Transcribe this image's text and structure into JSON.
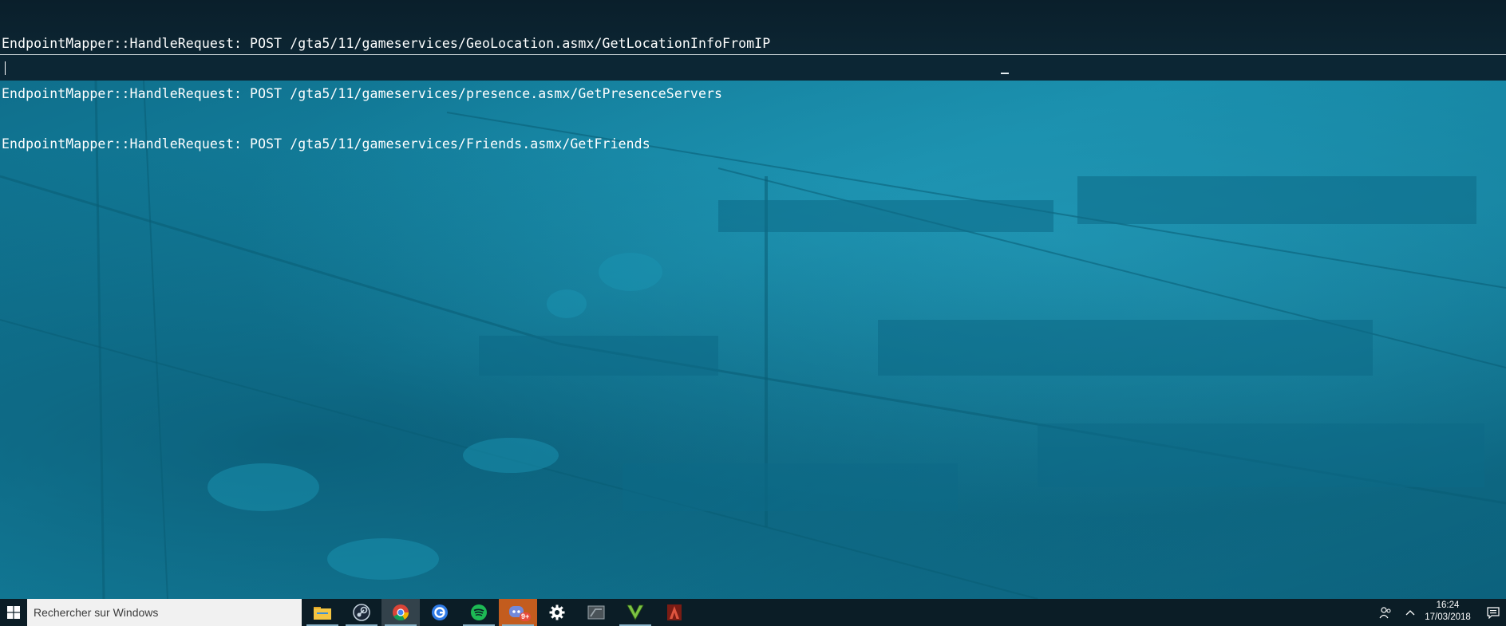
{
  "console": {
    "log_lines": [
      "EndpointMapper::HandleRequest: POST /gta5/11/gameservices/GeoLocation.asmx/GetLocationInfoFromIP",
      "EndpointMapper::HandleRequest: POST /gta5/11/gameservices/presence.asmx/GetPresenceServers",
      "EndpointMapper::HandleRequest: POST /gta5/11/gameservices/Friends.asmx/GetFriends"
    ],
    "input_value": ""
  },
  "taskbar": {
    "search_placeholder": "Rechercher sur Windows",
    "start_icon": "windows-logo-icon",
    "apps": [
      {
        "name": "file-explorer-icon",
        "color": "#f4c542"
      },
      {
        "name": "steam-icon",
        "color": "#c7d5e0"
      },
      {
        "name": "chrome-icon",
        "color": "#db4437"
      },
      {
        "name": "app-g-icon",
        "color": "#2f7be6"
      },
      {
        "name": "spotify-icon",
        "color": "#1db954"
      },
      {
        "name": "discord-icon",
        "color": "#7289da",
        "badge": "9+"
      },
      {
        "name": "settings-gear-icon",
        "color": "#ffffff"
      },
      {
        "name": "gta-launcher-icon",
        "color": "#9aa5ab"
      },
      {
        "name": "gta-v-icon",
        "color": "#7cc243"
      },
      {
        "name": "game-red-icon",
        "color": "#c0392b"
      }
    ],
    "tray": {
      "people_icon": "people-icon",
      "chevron_icon": "chevron-up-icon",
      "notification_icon": "notification-center-icon"
    },
    "clock": {
      "time": "16:24",
      "date": "17/03/2018"
    }
  },
  "colors": {
    "console_bg": "#0a1f2b",
    "game_tint": "#127f9c",
    "taskbar_bg": "#0b1d26",
    "accent_orange": "#c35c1e"
  }
}
